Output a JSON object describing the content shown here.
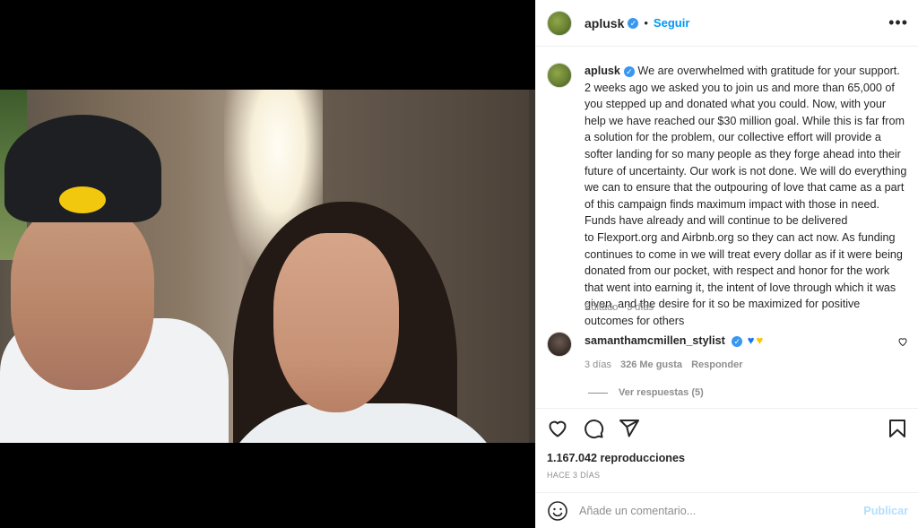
{
  "post": {
    "username": "aplusk",
    "follow_label": "Seguir",
    "dot": "•",
    "more_label": "•••",
    "caption": "We are overwhelmed with gratitude for your support. 2 weeks ago we asked you to join us and more than 65,000 of you stepped up and donated what you could. Now, with your help we have reached our $30 million goal. While this is far from a solution for the problem, our collective effort will provide a softer landing for so many people as they forge ahead into their future of uncertainty. Our work is not done. We will do everything we can to ensure that the outpouring of love that came as a part of this campaign finds maximum impact with those in need. Funds have already and will continue to be delivered\nto Flexport.org and Airbnb.org so they can act now. As funding continues to come in we will treat every dollar as if it were being donated from our pocket, with respect and honor for the work that went into earning it, the intent of love through which it was given, and the desire for it so be maximized for positive outcomes for others",
    "edited_label": "Editado · 3 días"
  },
  "comment": {
    "username": "samanthamcmillen_stylist",
    "time": "3 días",
    "likes": "326 Me gusta",
    "reply_label": "Responder",
    "view_replies": "Ver respuestas (5)"
  },
  "stats": {
    "views": "1.167.042 reproducciones",
    "ago": "HACE 3 DÍAS"
  },
  "composer": {
    "placeholder": "Añade un comentario...",
    "publish_label": "Publicar"
  },
  "colors": {
    "accent": "#0095f6",
    "verified": "#3897f0",
    "muted": "#8e8e8e"
  },
  "icons": [
    "verified-badge-icon",
    "more-options-icon",
    "heart-icon",
    "comment-icon",
    "share-icon",
    "bookmark-icon",
    "emoji-icon",
    "blue-heart-emoji",
    "yellow-heart-emoji"
  ]
}
